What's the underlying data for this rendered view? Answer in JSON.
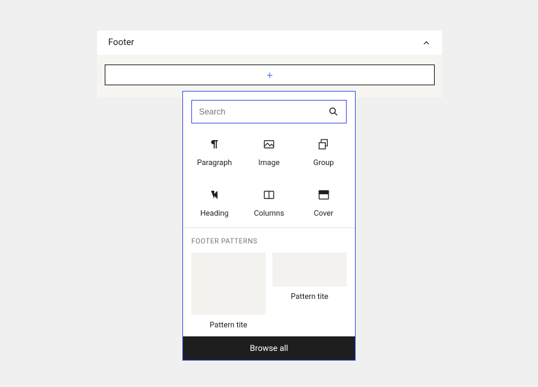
{
  "panel": {
    "title": "Footer"
  },
  "popover": {
    "search": {
      "placeholder": "Search"
    },
    "blocks": [
      {
        "label": "Paragraph",
        "icon": "paragraph-icon"
      },
      {
        "label": "Image",
        "icon": "image-icon"
      },
      {
        "label": "Group",
        "icon": "group-icon"
      },
      {
        "label": "Heading",
        "icon": "heading-icon"
      },
      {
        "label": "Columns",
        "icon": "columns-icon"
      },
      {
        "label": "Cover",
        "icon": "cover-icon"
      }
    ],
    "patterns_head": "FOOTER PATTERNS",
    "patterns": [
      {
        "title": "Pattern tite"
      },
      {
        "title": "Pattern tite"
      }
    ],
    "browse_all": "Browse all"
  }
}
